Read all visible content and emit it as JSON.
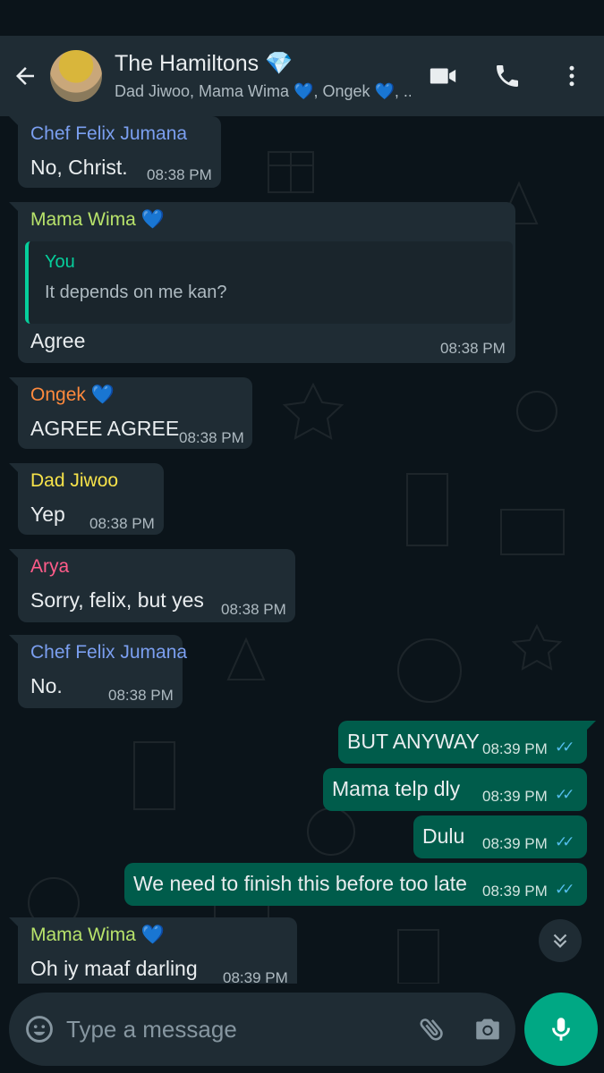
{
  "header": {
    "title": "The Hamiltons 💎",
    "subtitle": "Dad Jiwoo, Mama Wima 💙, Ongek 💙, .."
  },
  "messages": [
    {
      "sender": "Chef Felix Jumana",
      "text": "No, Christ.",
      "time": "08:38 PM"
    },
    {
      "sender": "Mama Wima 💙",
      "quote_author": "You",
      "quote_text": "It depends on me kan?",
      "text": "Agree",
      "time": "08:38 PM"
    },
    {
      "sender": "Ongek 💙",
      "text": "AGREE AGREE",
      "time": "08:38 PM"
    },
    {
      "sender": "Dad Jiwoo",
      "text": "Yep",
      "time": "08:38 PM"
    },
    {
      "sender": "Arya",
      "text": "Sorry, felix, but yes",
      "time": "08:38 PM"
    },
    {
      "sender": "Chef Felix Jumana",
      "text": "No.",
      "time": "08:38 PM"
    },
    {
      "text": "BUT ANYWAY",
      "time": "08:39 PM",
      "status": "read"
    },
    {
      "text": "Mama telp dly",
      "time": "08:39 PM",
      "status": "read"
    },
    {
      "text": "Dulu",
      "time": "08:39 PM",
      "status": "read"
    },
    {
      "text": "We need to finish this before too late",
      "time": "08:39 PM",
      "status": "read"
    },
    {
      "sender": "Mama Wima 💙",
      "text": "Oh iy maaf darling",
      "time": "08:39 PM"
    }
  ],
  "composer": {
    "placeholder": "Type a message"
  },
  "colors": {
    "header_bg": "#1f2c34",
    "incoming_bubble": "#1f2c34",
    "outgoing_bubble": "#005c4b",
    "accent": "#00a884",
    "read_ticks": "#53bdeb",
    "chef_felix": "#7b9ff0",
    "mama_wima": "#b8e36b",
    "ongek": "#ff8a3d",
    "dad_jiwoo": "#f7e34a",
    "arya": "#ff5c8a",
    "quote_you": "#06cf9c"
  },
  "icons": [
    "back-arrow-icon",
    "video-call-icon",
    "voice-call-icon",
    "more-options-icon",
    "scroll-down-icon",
    "emoji-icon",
    "attach-icon",
    "camera-icon",
    "mic-icon"
  ]
}
